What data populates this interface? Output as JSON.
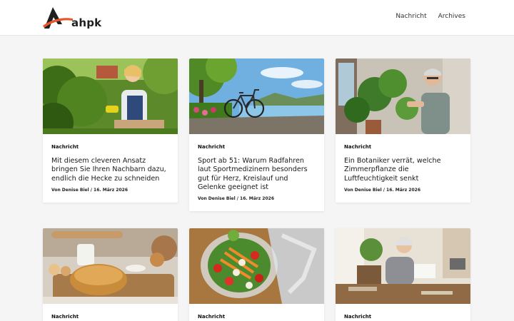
{
  "header": {
    "logo_text": "ahpk",
    "nav": [
      {
        "label": "Nachricht"
      },
      {
        "label": "Archives"
      }
    ]
  },
  "cards": [
    {
      "category": "Nachricht",
      "title": "Mit diesem cleveren Ansatz bringen Sie Ihren Nachbarn dazu, endlich die Hecke zu schneiden",
      "meta": "Von Denise Biel / 16. März 2026",
      "image": "woman-trimming-hedge-photo"
    },
    {
      "category": "Nachricht",
      "title": "Sport ab 51: Warum Radfahren laut Sportmedizinern besonders gut für Herz, Kreislauf und Gelenke geeignet ist",
      "meta": "Von Denise Biel / 16. März 2026",
      "image": "bicycle-by-river-photo"
    },
    {
      "category": "Nachricht",
      "title": "Ein Botaniker verrät, welche Zimmerpflanze die Luftfeuchtigkeit senkt",
      "meta": "Von Denise Biel / 16. März 2026",
      "image": "man-with-houseplants-photo"
    },
    {
      "category": "Nachricht",
      "title": "",
      "meta": "",
      "image": "bread-on-board-photo"
    },
    {
      "category": "Nachricht",
      "title": "",
      "meta": "",
      "image": "salad-bowl-photo"
    },
    {
      "category": "Nachricht",
      "title": "",
      "meta": "",
      "image": "woman-with-letter-photo"
    }
  ],
  "colors": {
    "logo_orange": "#e8552b",
    "logo_dark": "#1f1f1f",
    "page_bg": "#f5f5f5"
  }
}
